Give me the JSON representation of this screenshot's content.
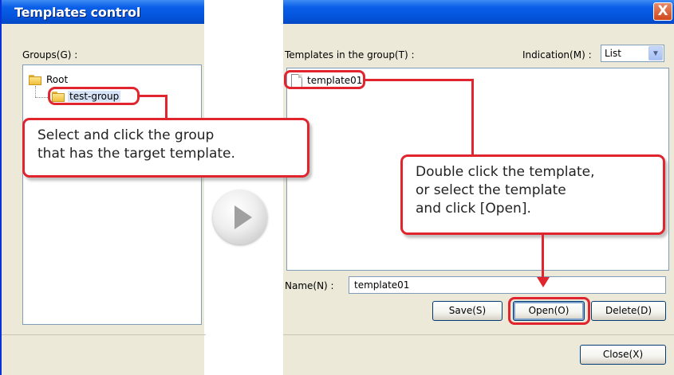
{
  "window": {
    "title": "Templates control",
    "close_glyph": "X"
  },
  "groups": {
    "label": "Groups(G) :",
    "tree": [
      {
        "label": "Root",
        "icon": "folder-icon"
      },
      {
        "label": "test-group",
        "icon": "folder-icon",
        "selected": true
      }
    ]
  },
  "templates": {
    "label": "Templates in the group(T) :",
    "indication_label": "Indication(M) :",
    "indication_value": "List",
    "items": [
      {
        "label": "template01",
        "icon": "document-icon"
      }
    ],
    "name_label": "Name(N) :",
    "name_value": "template01",
    "buttons": {
      "save": "Save(S)",
      "open": "Open(O)",
      "delete": "Delete(D)",
      "close": "Close(X)"
    }
  },
  "callouts": {
    "select_group": "Select and click the group\nthat has the target template.",
    "open_template": "Double click the template,\nor select the template\nand click [Open]."
  },
  "colors": {
    "accent_red": "#e0252f",
    "titlebar_blue": "#0454dc",
    "dialog_bg": "#ece9d8"
  }
}
